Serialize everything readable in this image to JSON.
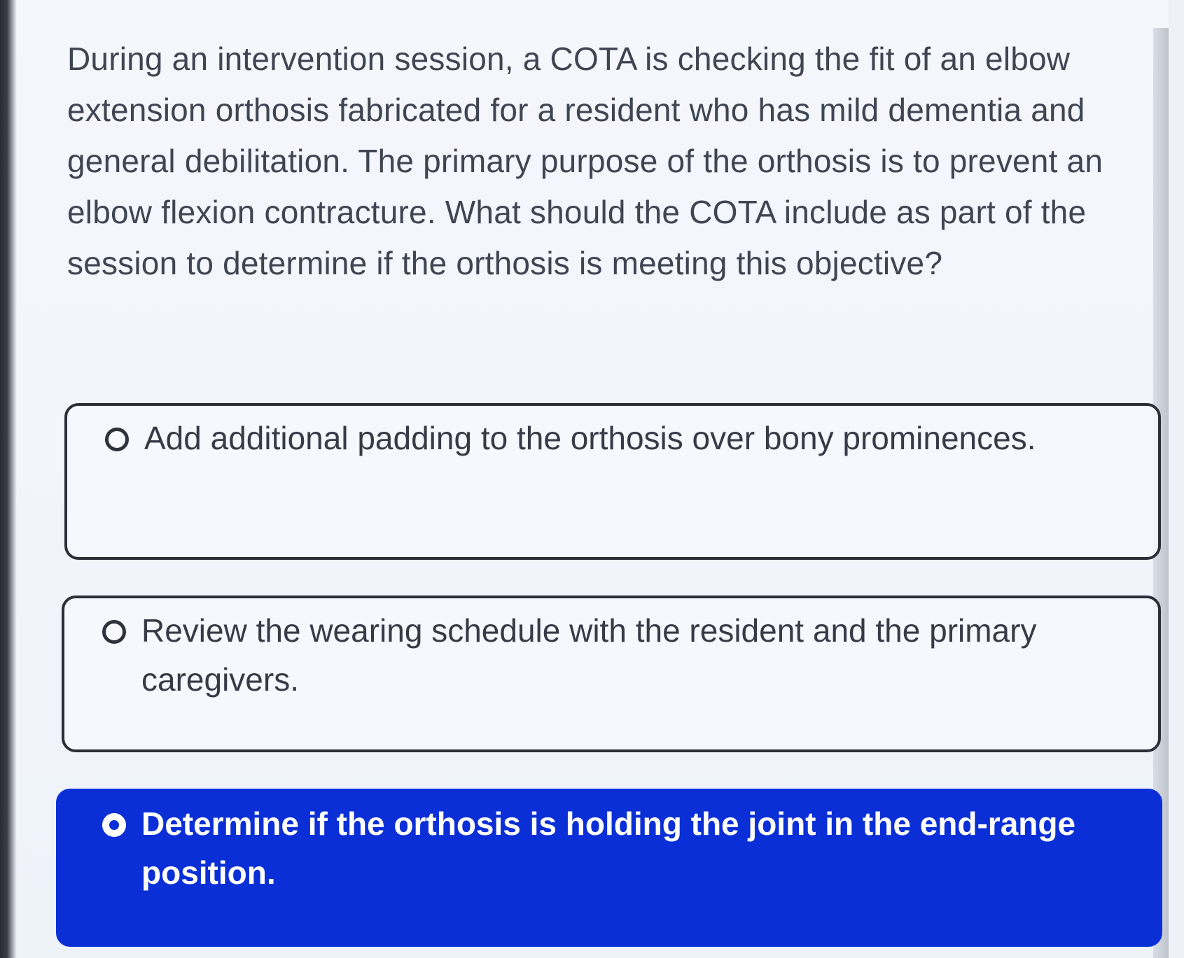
{
  "question": {
    "text": "During an intervention session, a COTA is checking the fit of an elbow extension orthosis fabricated for a resident who has mild dementia and general debilitation. The primary purpose of the orthosis is to prevent an elbow flexion contracture. What should the COTA include as part of the session to determine if the orthosis is meeting this objective?"
  },
  "options": [
    {
      "text": "Add additional padding to the orthosis over bony prominences.",
      "selected": false
    },
    {
      "text": "Review the wearing schedule with the resident and the primary caregivers.",
      "selected": false
    },
    {
      "text": "Determine if the orthosis is holding the joint in the end-range position.",
      "selected": true
    }
  ],
  "colors": {
    "selected_background": "#0b2fd6",
    "option_border": "#2c2f38",
    "question_text": "#404552"
  }
}
